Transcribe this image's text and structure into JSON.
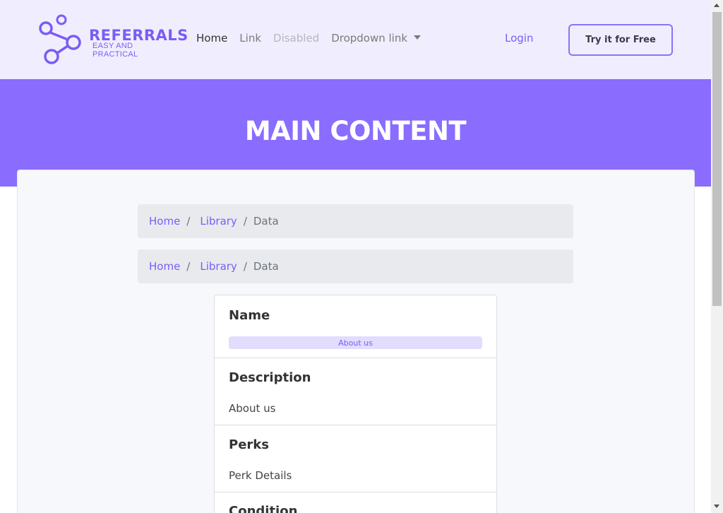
{
  "brand": {
    "title": "REFERRALS",
    "subtitle": "EASY AND PRACTICAL",
    "accent_color": "#7c5cf5",
    "icon": "share-nodes-icon"
  },
  "nav": {
    "links": [
      {
        "label": "Home",
        "state": "active"
      },
      {
        "label": "Link",
        "state": "normal"
      },
      {
        "label": "Disabled",
        "state": "disabled"
      },
      {
        "label": "Dropdown link",
        "state": "dropdown"
      }
    ],
    "login": "Login",
    "cta": "Try it for Free"
  },
  "hero": {
    "title": "MAIN CONTENT",
    "background": "#8a6cff"
  },
  "breadcrumbs": [
    {
      "items": [
        "Home",
        "Library",
        "Data"
      ]
    },
    {
      "items": [
        "Home",
        "Library",
        "Data"
      ]
    }
  ],
  "details": {
    "name": {
      "heading": "Name",
      "badge": "About us"
    },
    "description": {
      "heading": "Description",
      "value": "About us"
    },
    "perks": {
      "heading": "Perks",
      "value": "Perk Details"
    },
    "condition": {
      "heading": "Condition"
    }
  }
}
